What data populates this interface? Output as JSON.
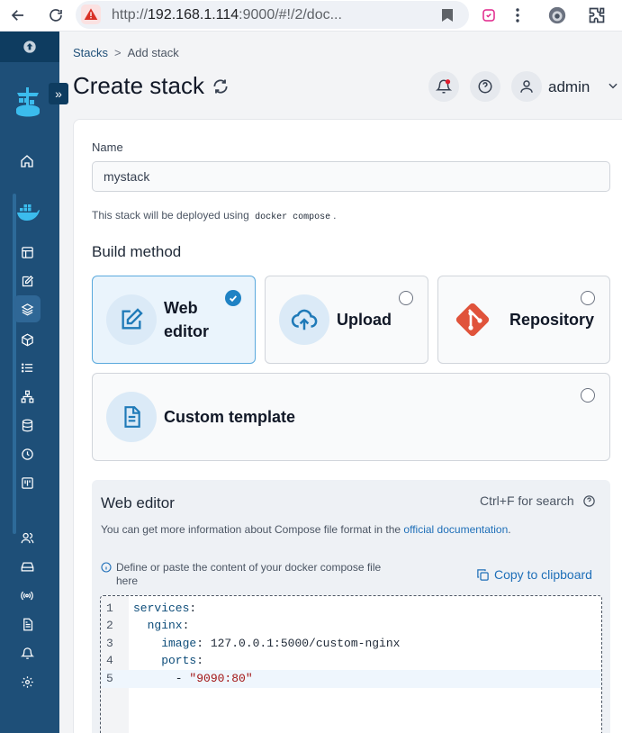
{
  "browser": {
    "url_host": "http://",
    "url_main": "192.168.1.114",
    "url_rest": ":9000/#!/2/doc..."
  },
  "breadcrumb": {
    "parent": "Stacks",
    "separator": ">",
    "current": "Add stack"
  },
  "page": {
    "title": "Create stack",
    "user": "admin"
  },
  "form": {
    "name_label": "Name",
    "name_value": "mystack",
    "help_prefix": "This stack will be deployed using",
    "help_code": "docker compose",
    "help_suffix": ".",
    "build_method_title": "Build method"
  },
  "build_methods": [
    {
      "label_line1": "Web",
      "label_line2": "editor",
      "selected": true
    },
    {
      "label": "Upload",
      "selected": false
    },
    {
      "label": "Repository",
      "selected": false
    },
    {
      "label": "Custom template",
      "selected": false
    }
  ],
  "web_editor": {
    "title": "Web editor",
    "search_hint": "Ctrl+F for search",
    "info_prefix": "You can get more information about Compose file format in the",
    "info_link": "official documentation",
    "info_suffix": ".",
    "hint": "Define or paste the content of your docker compose file here",
    "copy_label": "Copy to clipboard",
    "lines": [
      {
        "no": "1",
        "key": "services",
        "sep": ":",
        "val": ""
      },
      {
        "no": "2",
        "key": "  nginx",
        "sep": ":",
        "val": ""
      },
      {
        "no": "3",
        "key": "    image",
        "sep": ": ",
        "val": "127.0.0.1:5000/custom-nginx"
      },
      {
        "no": "4",
        "key": "    ports",
        "sep": ":",
        "val": ""
      },
      {
        "no": "5",
        "key": "      - ",
        "sep": "",
        "val": "\"9090:80\""
      }
    ]
  },
  "colors": {
    "sidebar": "#1e4f78",
    "accent": "#1f82c4",
    "link": "#1e6fb8"
  }
}
